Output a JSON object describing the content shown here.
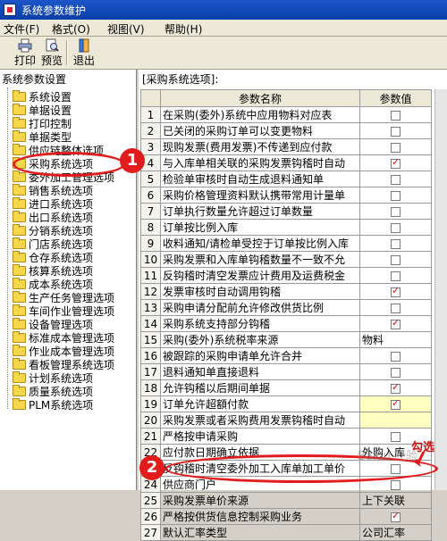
{
  "window": {
    "title": "系统参数维护"
  },
  "menu": [
    "文件(F)",
    "格式(O)",
    "视图(V)",
    "帮助(H)"
  ],
  "toolbar": {
    "print": "打印",
    "preview": "预览",
    "exit": "退出"
  },
  "left": {
    "caption": "系统参数设置",
    "items": [
      "系统设置",
      "单据设置",
      "打印控制",
      "单据类型",
      "供应链整体选项",
      "采购系统选项",
      "委外加工管理选项",
      "销售系统选项",
      "进口系统选项",
      "出口系统选项",
      "分销系统选项",
      "门店系统选项",
      "仓存系统选项",
      "核算系统选项",
      "成本系统选项",
      "生产任务管理选项",
      "车间作业管理选项",
      "设备管理选项",
      "标准成本管理选项",
      "作业成本管理选项",
      "看板管理系统选项",
      "计划系统选项",
      "质量系统选项",
      "PLM系统选项"
    ]
  },
  "right": {
    "caption": "[采购系统选项]:",
    "headers": {
      "name": "参数名称",
      "value": "参数值"
    },
    "rows": [
      {
        "n": "1",
        "name": "在采购(委外)系统中应用物料对应表",
        "type": "check",
        "checked": false
      },
      {
        "n": "2",
        "name": "已关闭的采购订单可以变更物料",
        "type": "check",
        "checked": false
      },
      {
        "n": "3",
        "name": "现购发票(费用发票)不传递到应付款",
        "type": "check",
        "checked": false
      },
      {
        "n": "4",
        "name": "与入库单相关联的采购发票钩稽时自动",
        "type": "check",
        "checked": true
      },
      {
        "n": "5",
        "name": "检验单审核时自动生成退料通知单",
        "type": "check",
        "checked": false
      },
      {
        "n": "6",
        "name": "采购价格管理资料默认携带常用计量单",
        "type": "check",
        "checked": false
      },
      {
        "n": "7",
        "name": "订单执行数量允许超过订单数量",
        "type": "check",
        "checked": false
      },
      {
        "n": "8",
        "name": "订单按比例入库",
        "type": "check",
        "checked": false
      },
      {
        "n": "9",
        "name": "收料通知/请检单受控于订单按比例入库",
        "type": "check",
        "checked": false
      },
      {
        "n": "10",
        "name": "采购发票和入库单钩稽数量不一致不允",
        "type": "check",
        "checked": false
      },
      {
        "n": "11",
        "name": "反钩稽时清空发票应计费用及运费税金",
        "type": "check",
        "checked": false
      },
      {
        "n": "12",
        "name": "发票审核时自动调用钩稽",
        "type": "check",
        "checked": true
      },
      {
        "n": "13",
        "name": "采购申请分配前允许修改供货比例",
        "type": "check",
        "checked": false
      },
      {
        "n": "14",
        "name": "采购系统支持部分钩稽",
        "type": "check",
        "checked": true
      },
      {
        "n": "15",
        "name": "采购(委外)系统税率来源",
        "type": "text",
        "value": "物料"
      },
      {
        "n": "16",
        "name": "被跟踪的采购申请单允许合并",
        "type": "check",
        "checked": false
      },
      {
        "n": "17",
        "name": "退料通知单直接退料",
        "type": "check",
        "checked": false
      },
      {
        "n": "18",
        "name": "允许钩稽以后期间单据",
        "type": "check",
        "checked": true
      },
      {
        "n": "19",
        "name": "订单允许超額付款",
        "type": "check",
        "checked": true,
        "hl": true
      },
      {
        "n": "20",
        "name": "采购发票或者采购费用发票钩稽时自动",
        "type": "blank",
        "hl": true
      },
      {
        "n": "21",
        "name": "严格按申请采购",
        "type": "check",
        "checked": false
      },
      {
        "n": "22",
        "name": "应付款日期确立依据",
        "type": "text",
        "value": "外购入库"
      },
      {
        "n": "23",
        "name": "反钩稽时清空委外加工入库单加工单价",
        "type": "check",
        "checked": false
      },
      {
        "n": "24",
        "name": "供应商门户",
        "type": "check",
        "checked": false
      },
      {
        "n": "25",
        "name": "采购发票单价来源",
        "type": "text",
        "value": "上下关联"
      },
      {
        "n": "26",
        "name": "严格按供货信息控制采购业务",
        "type": "check",
        "checked": true
      },
      {
        "n": "27",
        "name": "默认汇率类型",
        "type": "text",
        "value": "公司汇率"
      }
    ]
  },
  "annotations": {
    "badge1": "1",
    "badge2": "2",
    "gou": "勾选",
    "watermark": "Baidu 经验"
  },
  "colors": {
    "accent": "#e21c1c",
    "titlebar": "#0a3ea8"
  }
}
